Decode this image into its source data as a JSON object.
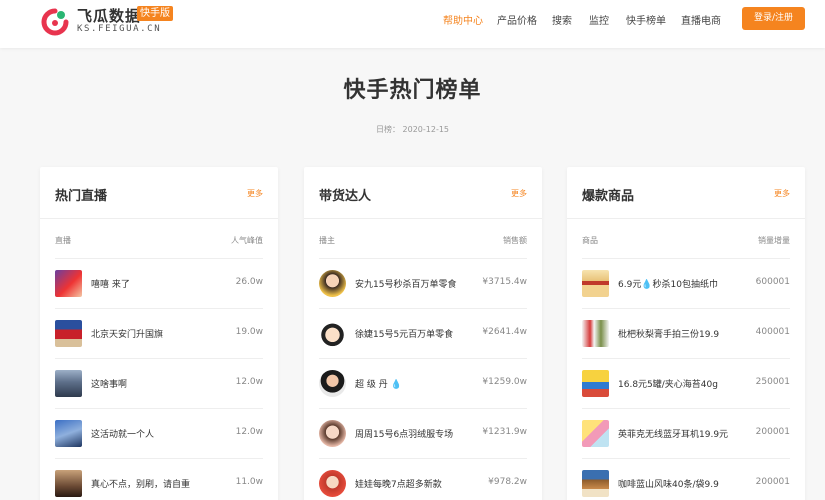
{
  "header": {
    "logo_cn": "飞瓜数据",
    "logo_badge": "快手版",
    "logo_en": "KS.FEIGUA.CN",
    "nav": [
      "帮助中心",
      "产品价格",
      "搜索",
      "监控",
      "快手榜单",
      "直播电商"
    ],
    "active_nav": "帮助中心",
    "login": "登录/注册",
    "accent": "#f5841f"
  },
  "page": {
    "title": "快手热门榜单",
    "date_label": "日榜：",
    "date": "2020-12-15"
  },
  "panels": [
    {
      "title": "热门直播",
      "more": "更多",
      "col_left": "直播",
      "col_right": "人气峰值",
      "rows": [
        {
          "name": "嘻嘻 来了",
          "value": "26.0w"
        },
        {
          "name": "北京天安门升国旗",
          "value": "19.0w"
        },
        {
          "name": "这啥事啊",
          "value": "12.0w"
        },
        {
          "name": "这活动就一个人",
          "value": "12.0w"
        },
        {
          "name": "真心不点，别刷，请自重",
          "value": "11.0w"
        }
      ]
    },
    {
      "title": "带货达人",
      "more": "更多",
      "col_left": "播主",
      "col_right": "销售额",
      "rows": [
        {
          "name": "安九15号秒杀百万单零食",
          "value": "¥3715.4w"
        },
        {
          "name": "徐婕15号5元百万单零食",
          "value": "¥2641.4w"
        },
        {
          "name": "超 级 丹 💧",
          "value": "¥1259.0w"
        },
        {
          "name": "周周15号6点羽绒服专场",
          "value": "¥1231.9w"
        },
        {
          "name": "娃娃每晚7点超多新款",
          "value": "¥978.2w"
        }
      ]
    },
    {
      "title": "爆款商品",
      "more": "更多",
      "col_left": "商品",
      "col_right": "销量增量",
      "rows": [
        {
          "name": "6.9元💧秒杀10包抽纸巾",
          "value": "600001"
        },
        {
          "name": "枇杷秋梨膏手拍三份19.9",
          "value": "400001"
        },
        {
          "name": "16.8元5罐/夹心海苔40g",
          "value": "250001"
        },
        {
          "name": "英菲克无线蓝牙耳机19.9元",
          "value": "200001"
        },
        {
          "name": "咖啡蓝山风味40条/袋9.9",
          "value": "200001"
        }
      ]
    }
  ]
}
